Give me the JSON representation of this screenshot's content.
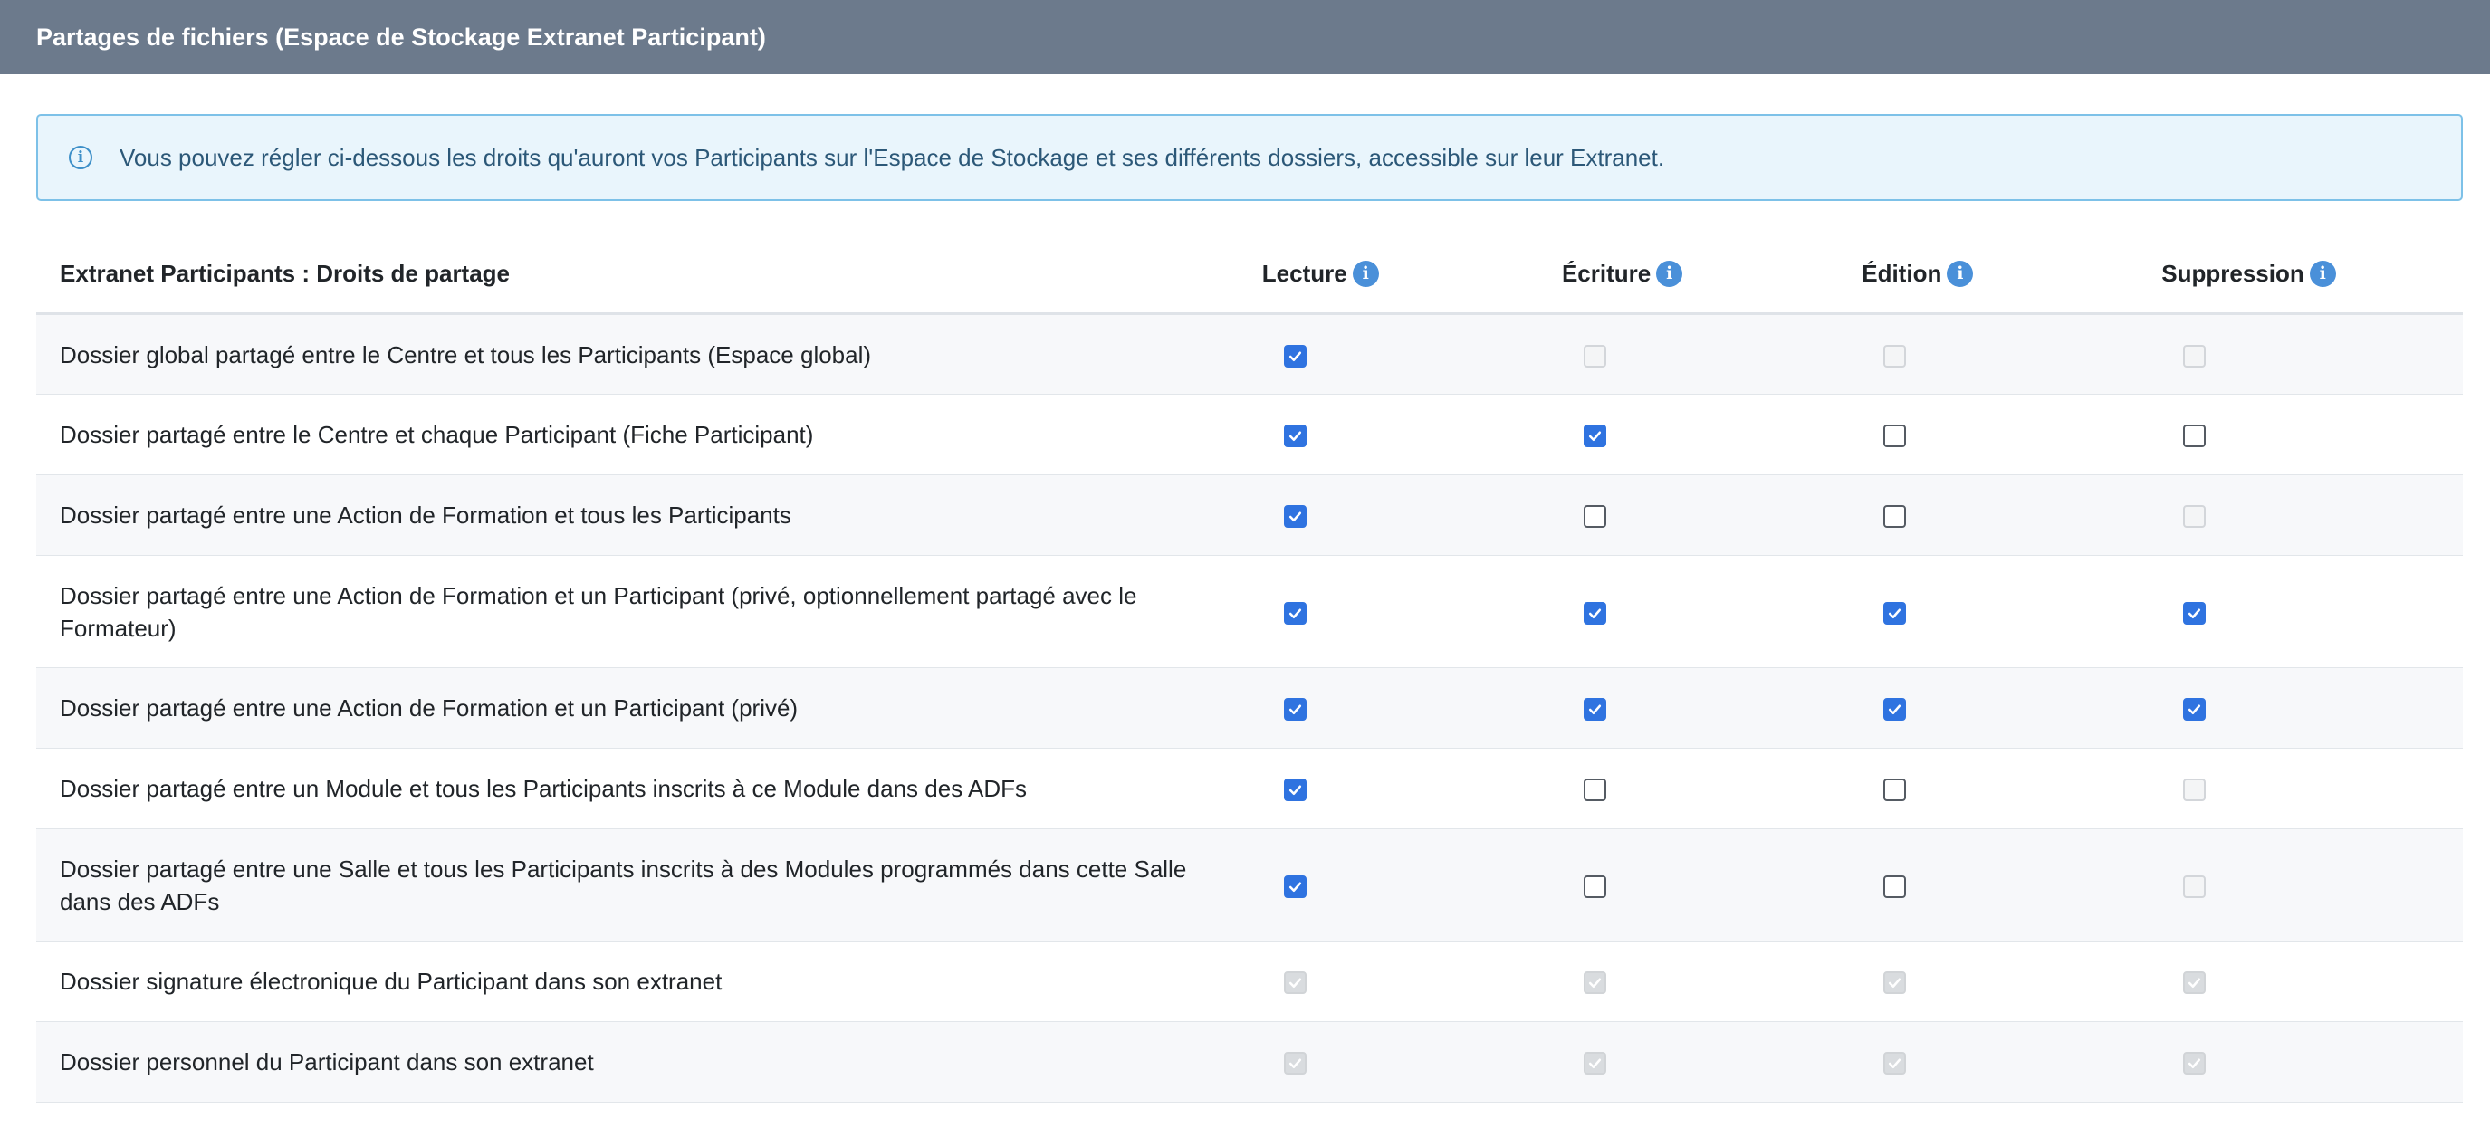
{
  "header": {
    "title": "Partages de fichiers (Espace de Stockage Extranet Participant)"
  },
  "info": {
    "icon": "info-circle-icon",
    "text": "Vous pouvez régler ci-dessous les droits qu'auront vos Participants sur l'Espace de Stockage et ses différents dossiers, accessible sur leur Extranet."
  },
  "table": {
    "headers": {
      "label": "Extranet Participants : Droits de partage",
      "lecture": "Lecture",
      "ecriture": "Écriture",
      "edition": "Édition",
      "suppression": "Suppression"
    },
    "rows": [
      {
        "label": "Dossier global partagé entre le Centre et tous les Participants (Espace global)",
        "perms": [
          "checked",
          "disabled",
          "disabled",
          "disabled"
        ]
      },
      {
        "label": "Dossier partagé entre le Centre et chaque Participant (Fiche Participant)",
        "perms": [
          "checked",
          "checked",
          "unchecked",
          "unchecked"
        ]
      },
      {
        "label": "Dossier partagé entre une Action de Formation et tous les Participants",
        "perms": [
          "checked",
          "unchecked",
          "unchecked",
          "disabled"
        ]
      },
      {
        "label": "Dossier partagé entre une Action de Formation et un Participant (privé, optionnellement partagé avec le Formateur)",
        "perms": [
          "checked",
          "checked",
          "checked",
          "checked"
        ]
      },
      {
        "label": "Dossier partagé entre une Action de Formation et un Participant (privé)",
        "perms": [
          "checked",
          "checked",
          "checked",
          "checked"
        ]
      },
      {
        "label": "Dossier partagé entre un Module et tous les Participants inscrits à ce Module dans des ADFs",
        "perms": [
          "checked",
          "unchecked",
          "unchecked",
          "disabled"
        ]
      },
      {
        "label": "Dossier partagé entre une Salle et tous les Participants inscrits à des Modules programmés dans cette Salle dans des ADFs",
        "perms": [
          "checked",
          "unchecked",
          "unchecked",
          "disabled"
        ]
      },
      {
        "label": "Dossier signature électronique du Participant dans son extranet",
        "perms": [
          "disabled-checked",
          "disabled-checked",
          "disabled-checked",
          "disabled-checked"
        ]
      },
      {
        "label": "Dossier personnel du Participant dans son extranet",
        "perms": [
          "disabled-checked",
          "disabled-checked",
          "disabled-checked",
          "disabled-checked"
        ]
      }
    ]
  },
  "colors": {
    "header_bg": "#6c7a8c",
    "checkbox_checked": "#2f73e0",
    "help_icon": "#4a90d9",
    "info_border": "#7dc1e8",
    "info_bg": "#e9f5fc"
  }
}
